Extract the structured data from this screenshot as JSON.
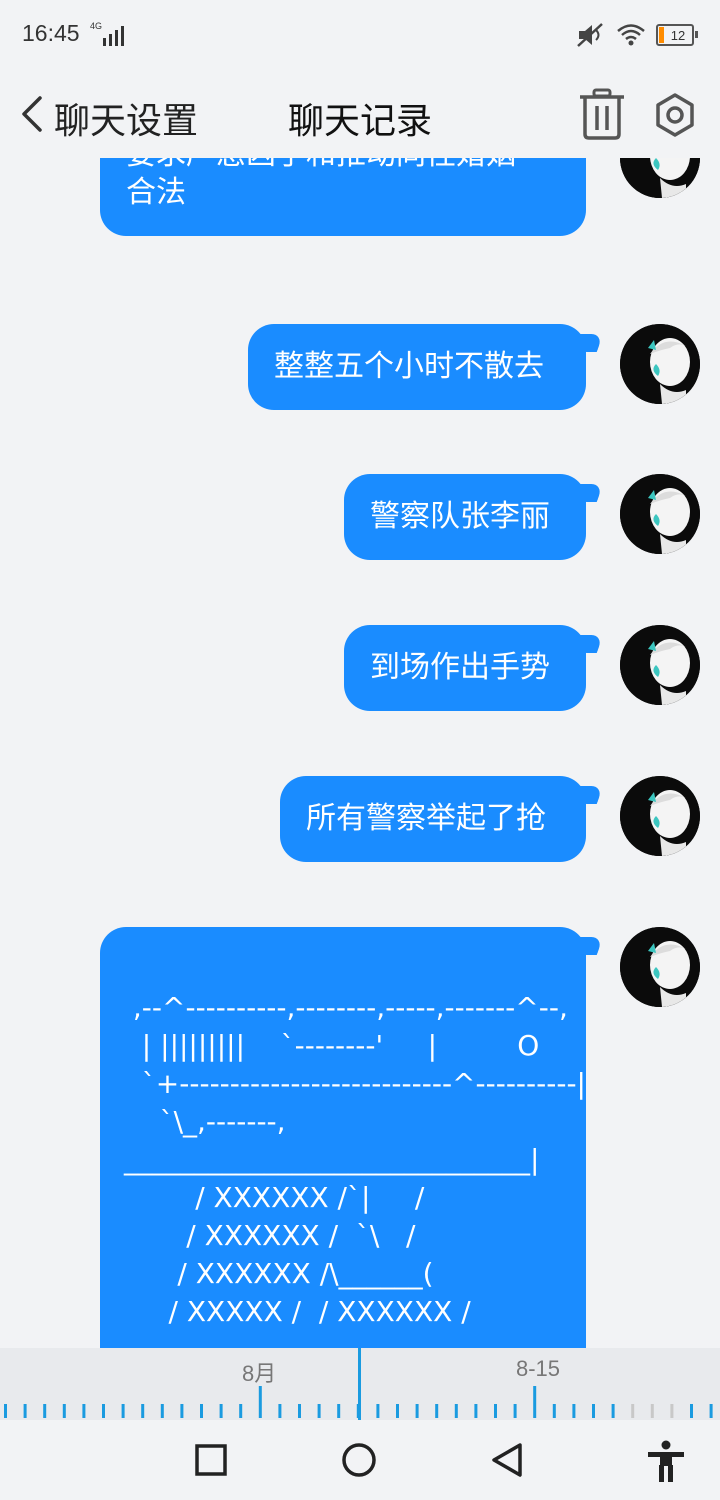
{
  "status_bar": {
    "time": "16:45",
    "network": "4G",
    "battery_level": "12",
    "battery_fill_fraction": 0.12,
    "icons": [
      "signal-icon",
      "mute-icon",
      "wifi-icon",
      "battery-icon"
    ]
  },
  "nav": {
    "back_label": "聊天设置",
    "title": "聊天记录",
    "icons": [
      "chevron-left-icon",
      "trash-icon",
      "gear-icon"
    ]
  },
  "messages": [
    {
      "lines": [
        "要求严惩凶手和推动同性婚姻",
        "合法"
      ]
    },
    {
      "lines": [
        "整整五个小时不散去"
      ]
    },
    {
      "lines": [
        "警察队张李丽"
      ]
    },
    {
      "lines": [
        "到场作出手势"
      ]
    },
    {
      "lines": [
        "所有警察举起了抢"
      ]
    },
    {
      "lines": [
        " ,--^----------,--------,-----,-------^--,",
        "  | |||||||||    `--------'     |         O",
        "  `+---------------------------^----------|",
        "    `\\_,-------,",
        "_____________________________|",
        "        / XXXXXX /`|     /",
        "       / XXXXXX /  `\\   /",
        "      / XXXXXX /\\______(",
        "     / XXXXX /  / XXXXXX /"
      ]
    }
  ],
  "timeline": {
    "labels": [
      "8月",
      "8-15"
    ]
  },
  "colors": {
    "bubble": "#1a8cff",
    "background": "#f2f3f5",
    "timeline_tick": "#1a9be0"
  }
}
